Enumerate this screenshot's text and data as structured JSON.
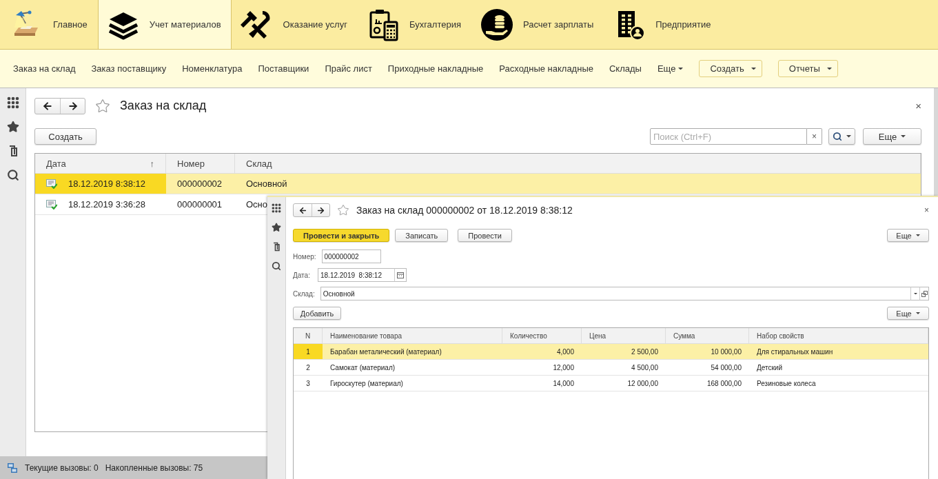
{
  "sections": [
    {
      "kind": "lamp",
      "label": "Главное",
      "selected": false
    },
    {
      "kind": "layers",
      "label": "Учет материалов",
      "selected": true
    },
    {
      "kind": "tools",
      "label": "Оказание услуг",
      "selected": false
    },
    {
      "kind": "accounting",
      "label": "Бухгалтерия",
      "selected": false
    },
    {
      "kind": "coins",
      "label": "Расчет зарплаты",
      "selected": false
    },
    {
      "kind": "building",
      "label": "Предприятие",
      "selected": false
    }
  ],
  "nav": {
    "links": [
      "Заказ на склад",
      "Заказ поставщику",
      "Номенклатура",
      "Поставщики",
      "Прайс лист",
      "Приходные накладные",
      "Расходные накладные",
      "Склады"
    ],
    "more": "Еще",
    "buttons": [
      "Создать",
      "Отчеты"
    ]
  },
  "list_window": {
    "title": "Заказ на склад",
    "close": "×",
    "create": "Создать",
    "search": {
      "placeholder": "Поиск (Ctrl+F)",
      "clear": "×"
    },
    "more": "Еще",
    "columns": [
      {
        "label": "Дата",
        "sort_mark": "↑"
      },
      {
        "label": "Номер"
      },
      {
        "label": "Склад"
      }
    ],
    "rows": [
      {
        "date": "18.12.2019 8:38:12",
        "number": "000000002",
        "warehouse": "Основной",
        "selected": true
      },
      {
        "date": "18.12.2019 3:36:28",
        "number": "000000001",
        "warehouse": "Осно",
        "selected": false
      }
    ]
  },
  "form_window": {
    "title": "Заказ на склад 000000002 от 18.12.2019 8:38:12",
    "close": "×",
    "buttons": [
      {
        "label": "Провести и закрыть",
        "kind": "primary"
      },
      {
        "label": "Записать",
        "kind": "plain"
      },
      {
        "label": "Провести",
        "kind": "plain"
      }
    ],
    "more": "Еще",
    "number": {
      "label": "Номер:",
      "value": "000000002"
    },
    "date": {
      "label": "Дата:",
      "value": "18.12.2019  8:38:12"
    },
    "warehouse": {
      "label": "Склад:",
      "value": "Основной"
    },
    "add": "Добавить",
    "table_more": "Еще",
    "columns": [
      "N",
      "Наименование товара",
      "Количество",
      "Цена",
      "Сумма",
      "Набор свойств"
    ],
    "rows": [
      {
        "n": "1",
        "name": "Барабан металический (материал)",
        "qty": "4,000",
        "price": "2 500,00",
        "sum": "10 000,00",
        "props": "Для стиральных машин",
        "selected": true
      },
      {
        "n": "2",
        "name": "Самокат (материал)",
        "qty": "12,000",
        "price": "4 500,00",
        "sum": "54 000,00",
        "props": "Детский",
        "selected": false
      },
      {
        "n": "3",
        "name": "Гироскутер (материал)",
        "qty": "14,000",
        "price": "12 000,00",
        "sum": "168 000,00",
        "props": "Резиновые колеса",
        "selected": false
      }
    ]
  },
  "status_bar": {
    "current": "Текущие вызовы: 0",
    "accumulated": "Накопленные вызовы: 75"
  }
}
